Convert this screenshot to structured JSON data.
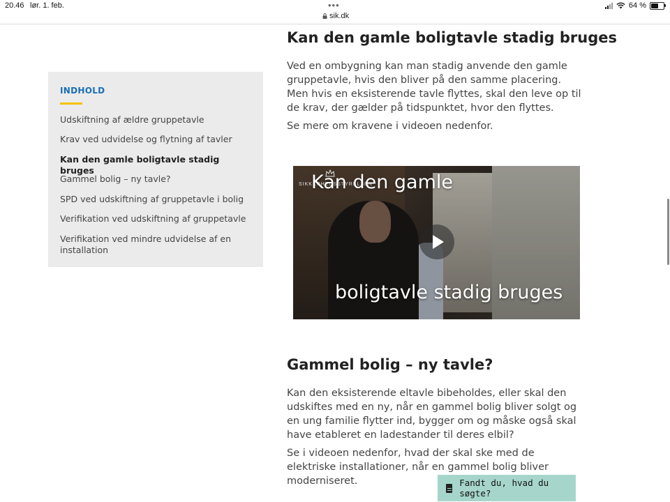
{
  "status_bar": {
    "time": "20.46",
    "date": "lør. 1. feb.",
    "url": "sik.dk",
    "battery": "64 %",
    "battery_level": 0.64
  },
  "toc": {
    "title": "INDHOLD",
    "items": [
      {
        "label": "Udskiftning af ældre gruppetavle"
      },
      {
        "label": "Krav ved udvidelse og flytning af tavler"
      },
      {
        "label": "Kan den gamle boligtavle stadig bruges"
      },
      {
        "label": "Gammel bolig – ny tavle?"
      },
      {
        "label": "SPD ved udskiftning af gruppetavle i bolig"
      },
      {
        "label": "Verifikation ved udskiftning af gruppetavle"
      },
      {
        "label": "Verifikation ved mindre udvidelse af en installation"
      }
    ],
    "active_index": 2
  },
  "section1": {
    "heading": "Kan den gamle boligtavle stadig bruges",
    "paragraph1": "Ved en ombygning kan man stadig anvende den gamle gruppetavle, hvis den bliver på den samme placering. Men hvis en eksisterende tavle flyttes, skal den leve op til de krav, der gælder på tidspunktet, hvor den flyttes.",
    "paragraph2": "Se mere om kravene i videoen nedenfor."
  },
  "video": {
    "caption_top": "Kan den gamle",
    "caption_bottom": "boligtavle stadig bruges",
    "logo_text": "SIKKERHEDSSTYRELSEN"
  },
  "section2": {
    "heading": "Gammel bolig – ny tavle?",
    "paragraph1": "Kan den eksisterende eltavle bibeholdes, eller skal den udskiftes med en ny, når en gammel bolig bliver solgt og en ung familie flytter ind, bygger om og måske også skal have etableret en ladestander til deres elbil?",
    "paragraph2": "Se i videoen nedenfor, hvad der skal ske med de elektriske installationer, når en gammel bolig bliver moderniseret."
  },
  "feedback": {
    "label": "Fandt du, hvad du søgte?",
    "icon": "document-icon"
  },
  "colors": {
    "accent_blue": "#1b6fb5",
    "underline_yellow": "#f2c200",
    "toc_background": "#ebebeb",
    "feedback_background": "#a6d6cb"
  }
}
